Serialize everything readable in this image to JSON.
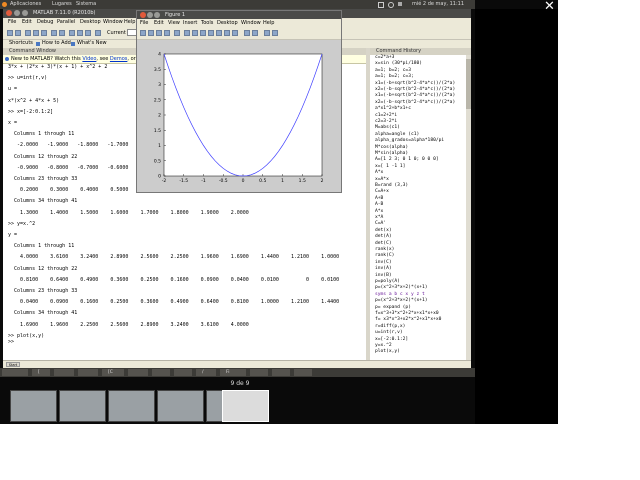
{
  "panel": {
    "applications": "Aplicaciones",
    "places": "Lugares",
    "system": "Sistema",
    "datetime": "mié 2 de may, 11:11"
  },
  "matlab": {
    "title": "MATLAB 7.11.0 (R2010b)",
    "menu": [
      "File",
      "Edit",
      "Debug",
      "Parallel",
      "Desktop",
      "Window",
      "Help"
    ],
    "current_folder_label": "Current",
    "shortcuts": "Shortcuts",
    "how_to_add": "How to Add",
    "whats_new": "What's New",
    "command_window_title": "Command Window",
    "notice": {
      "prefix": "New to MATLAB? Watch this",
      "video_link": "Video",
      "middle": ", see",
      "demos_link": "Demos",
      "suffix": ", or read"
    },
    "command_lines": [
      "3*x + (2*x + 3)*(x + 1) + x^2 + 2",
      "",
      ">> u=int(r,v)",
      "",
      "u =",
      "",
      "x*(x^2 + 4*x + 5)",
      "",
      ">> x=[-2:0.1:2]",
      "",
      "x =",
      "",
      "  Columns 1 through 11",
      "",
      "   -2.0000   -1.9000   -1.8000   -1.7000",
      "",
      "  Columns 12 through 22",
      "",
      "   -0.9000   -0.8000   -0.7000   -0.6000",
      "",
      "  Columns 23 through 33",
      "",
      "    0.2000    0.3000    0.4000    0.5000    0.6000    0.7000    0.8000    0.9000    1.0000    1.1000    1.2000",
      "",
      "  Columns 34 through 41",
      "",
      "    1.3000    1.4000    1.5000    1.6000    1.7000    1.8000    1.9000    2.0000",
      "",
      ">> y=x.^2",
      "",
      "y =",
      "",
      "  Columns 1 through 11",
      "",
      "    4.0000    3.6100    3.2400    2.8900    2.5600    2.2500    1.9600    1.6900    1.4400    1.2100    1.0000",
      "",
      "  Columns 12 through 22",
      "",
      "    0.8100    0.6400    0.4900    0.3600    0.2500    0.1600    0.0900    0.0400    0.0100         0    0.0100",
      "",
      "  Columns 23 through 33",
      "",
      "    0.0400    0.0900    0.1600    0.2500    0.3600    0.4900    0.6400    0.8100    1.0000    1.2100    1.4400",
      "",
      "  Columns 34 through 41",
      "",
      "    1.6900    1.9600    2.2500    2.5600    2.8900    3.2400    3.6100    4.0000",
      "",
      ">> plot(x,y)"
    ],
    "prompt": ">>",
    "command_history_title": "Command History",
    "history": [
      "c=2*a+3",
      "x=sin (30*pi/180)",
      "a=1; b=2; c=3",
      "a=1; b=2; c=3;",
      "x1=(-b+sqrt(b^2-4*a*c))/(2*a)",
      "x2=(-b-sqrt(b^2-4*a*c))/(2*a)",
      "x1=(-b+sqrt(b^2-4*a*c))/(2*a)",
      "x2=(-b-sqrt(b^2-4*a*c))/(2*a)",
      "a*x1^2+b*x1+c",
      "c1=2+2*i",
      "c2=3-2*i",
      "M=abs(c1)",
      "alpha=angle (c1)",
      "alpha_grados=alpha*180/pi",
      "M*cos(alpha)",
      "M*sin(alpha)",
      "A=[1 2 3; 0 1 0; 0 0 0]",
      "x=[ 1 -1 1]",
      "A*x",
      "x=A*x",
      "B=rand (3,3)",
      "C=A+x",
      "A+B",
      "A-B",
      "A*x",
      "x*A",
      "C=A'",
      "det(x)",
      "det(A)",
      "det(C)",
      "rank(x)",
      "rank(C)",
      "inv(C)",
      "inv(A)",
      "inv(B)",
      "p=poly(A)",
      "p=(x^2+3*x+2)*(x+1)",
      "syms a b c x y z t",
      "p=(x^2+3*x+2)*(x+1)",
      "p= expand (p)",
      "f=x^3+3*x^2+2*x+x1*x+x0",
      "f= x3*x^3+x2*x^2+x1*x+x0",
      "r=diff(p,x)",
      "u=int(r,v)",
      "x=[-2:0.1:2]",
      "y=x.^2",
      "plot(x,y)"
    ],
    "history_highlight_index": 37,
    "statusbar": "Start"
  },
  "figure": {
    "title": "Figure 1",
    "menu": [
      "File",
      "Edit",
      "View",
      "Insert",
      "Tools",
      "Desktop",
      "Window",
      "Help"
    ]
  },
  "chart_data": {
    "type": "line",
    "x_start": -2,
    "x_end": 2,
    "x_step": 0.1,
    "expression": "y = x.^2",
    "xlim": [
      -2,
      2
    ],
    "ylim": [
      0,
      4
    ],
    "xticks": [
      "-2",
      "-1.5",
      "-1",
      "-0.5",
      "0",
      "0.5",
      "1",
      "1.5",
      "2"
    ],
    "yticks": [
      "0",
      "0.5",
      "1",
      "1.5",
      "2",
      "2.5",
      "3",
      "3.5",
      "4"
    ],
    "line_color": "#4040ff",
    "grid": false
  },
  "taskbar": {
    "items": [
      "",
      "[",
      "",
      "",
      "[C",
      "",
      "",
      "",
      "/",
      "Fi",
      "",
      "",
      ""
    ]
  },
  "switcher": {
    "label": "9 de 9",
    "workspaces": 5
  },
  "close_glyph": "✕"
}
